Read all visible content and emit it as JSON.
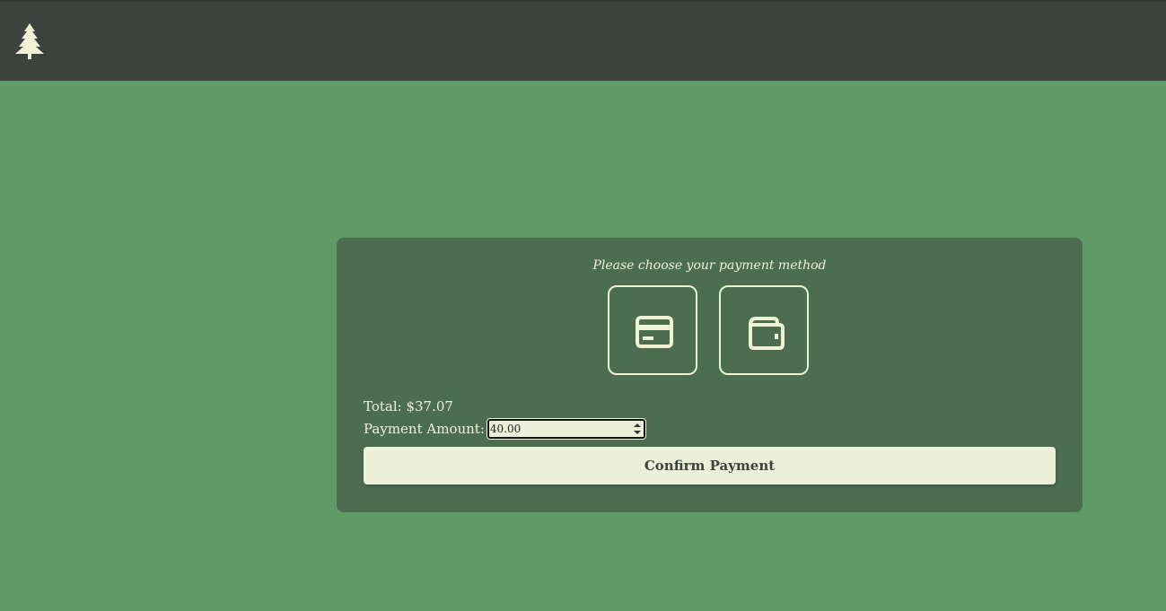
{
  "header": {
    "logo_icon": "pine-tree-icon"
  },
  "payment": {
    "prompt": "Please choose your payment method",
    "methods": [
      {
        "icon": "credit-card-icon"
      },
      {
        "icon": "wallet-icon"
      }
    ],
    "total_label": "Total: $37.07",
    "amount_label": "Payment Amount:",
    "amount_value": "40.00",
    "confirm_label": "Confirm Payment"
  },
  "colors": {
    "page_bg": "#609a66",
    "header_bg": "#3c423d",
    "card_bg": "#4d6d51",
    "accent_text": "#eef3d6"
  }
}
